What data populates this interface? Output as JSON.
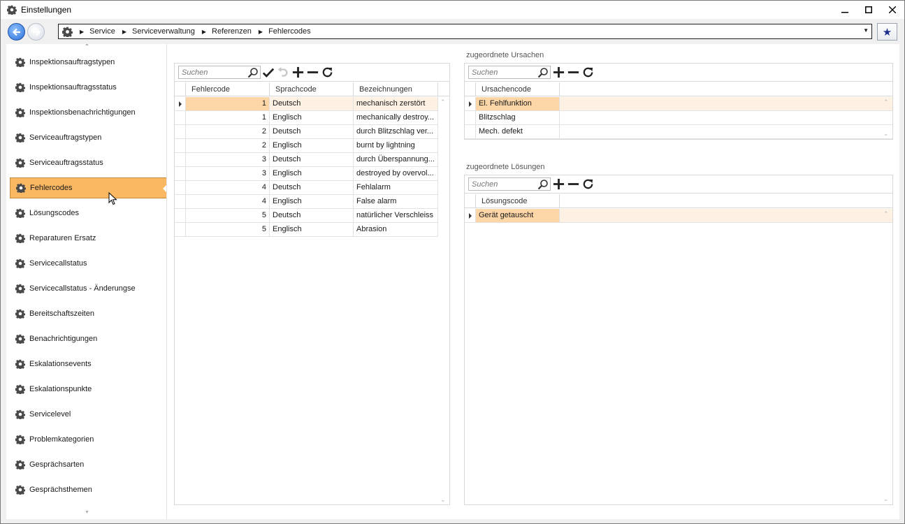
{
  "window": {
    "title": "Einstellungen",
    "controls": {
      "minimize": "—",
      "maximize": "☐",
      "close": "✕"
    }
  },
  "navigation": {
    "breadcrumbs": [
      "Service",
      "Serviceverwaltung",
      "Referenzen",
      "Fehlercodes"
    ],
    "favorite_icon": "star-icon"
  },
  "sidebar": {
    "items": [
      {
        "label": "Inspektionsauftragstypen"
      },
      {
        "label": "Inspektionsauftragsstatus"
      },
      {
        "label": "Inspektionsbenachrichtigungen"
      },
      {
        "label": "Serviceauftragstypen"
      },
      {
        "label": "Serviceauftragsstatus"
      },
      {
        "label": "Fehlercodes",
        "active": true
      },
      {
        "label": "Lösungscodes"
      },
      {
        "label": "Reparaturen Ersatz"
      },
      {
        "label": "Servicecallstatus"
      },
      {
        "label": "Servicecallstatus - Änderungse"
      },
      {
        "label": "Bereitschaftszeiten"
      },
      {
        "label": "Benachrichtigungen"
      },
      {
        "label": "Eskalationsevents"
      },
      {
        "label": "Eskalationspunkte"
      },
      {
        "label": "Servicelevel"
      },
      {
        "label": "Problemkategorien"
      },
      {
        "label": "Gesprächsarten"
      },
      {
        "label": "Gesprächsthemen"
      }
    ]
  },
  "fehlercodes": {
    "search_placeholder": "Suchen",
    "columns": [
      "Fehlercode",
      "Sprachcode",
      "Bezeichnungen"
    ],
    "rows": [
      {
        "code": "1",
        "lang": "Deutsch",
        "desc": "mechanisch zerstört"
      },
      {
        "code": "1",
        "lang": "Englisch",
        "desc": "mechanically destroy..."
      },
      {
        "code": "2",
        "lang": "Deutsch",
        "desc": "durch Blitzschlag ver..."
      },
      {
        "code": "2",
        "lang": "Englisch",
        "desc": "burnt by lightning"
      },
      {
        "code": "3",
        "lang": "Deutsch",
        "desc": "durch Überspannung..."
      },
      {
        "code": "3",
        "lang": "Englisch",
        "desc": "destroyed by overvol..."
      },
      {
        "code": "4",
        "lang": "Deutsch",
        "desc": "Fehlalarm"
      },
      {
        "code": "4",
        "lang": "Englisch",
        "desc": "False alarm"
      },
      {
        "code": "5",
        "lang": "Deutsch",
        "desc": "natürlicher Verschleiss"
      },
      {
        "code": "5",
        "lang": "Englisch",
        "desc": "Abrasion"
      }
    ]
  },
  "ursachen": {
    "caption": "zugeordnete Ursachen",
    "search_placeholder": "Suchen",
    "columns": [
      "Ursachencode"
    ],
    "rows": [
      {
        "code": "El. Fehlfunktion"
      },
      {
        "code": "Blitzschlag"
      },
      {
        "code": "Mech. defekt"
      }
    ]
  },
  "loesungen": {
    "caption": "zugeordnete Lösungen",
    "search_placeholder": "Suchen",
    "columns": [
      "Lösungscode"
    ],
    "rows": [
      {
        "code": "Gerät getauscht"
      }
    ]
  },
  "colors": {
    "active_item": "#fbb862",
    "selected_row": "#fdf1e3",
    "focus_cell": "#fdd6a8"
  }
}
